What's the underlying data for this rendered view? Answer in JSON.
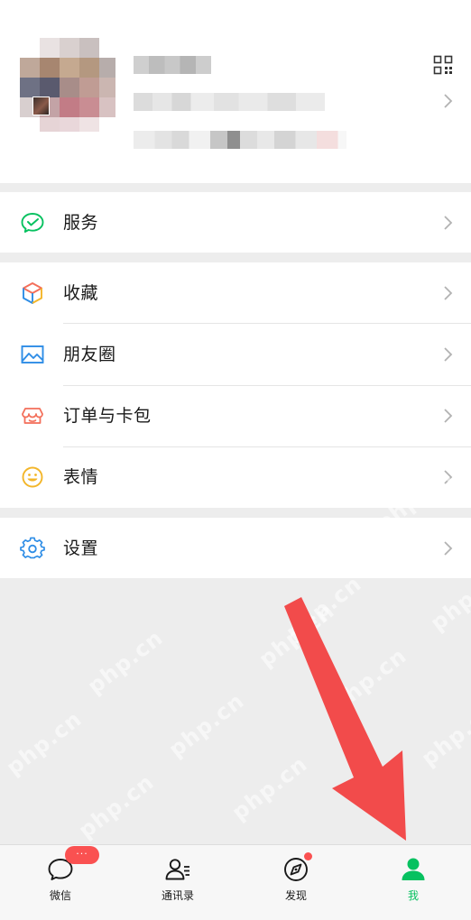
{
  "menu": {
    "services": {
      "label": "服务",
      "icon": "wechat-pay-icon"
    },
    "collections": {
      "label": "收藏",
      "icon": "cube-icon"
    },
    "moments": {
      "label": "朋友圈",
      "icon": "image-icon"
    },
    "orders_cards": {
      "label": "订单与卡包",
      "icon": "wallet-icon"
    },
    "stickers": {
      "label": "表情",
      "icon": "smiley-icon"
    },
    "settings": {
      "label": "设置",
      "icon": "gear-icon"
    }
  },
  "tabbar": {
    "tabs": [
      {
        "label": "微信",
        "icon": "chat-bubble-icon",
        "active": false
      },
      {
        "label": "通讯录",
        "icon": "contacts-icon",
        "active": false
      },
      {
        "label": "发现",
        "icon": "compass-icon",
        "active": false
      },
      {
        "label": "我",
        "icon": "person-icon",
        "active": true
      }
    ],
    "chats_badge": "···"
  },
  "watermark": "php.cn",
  "colors": {
    "accent_green": "#07c160",
    "badge_red": "#fa5151",
    "arrow_red": "#f24b4b",
    "background": "#ededed"
  }
}
